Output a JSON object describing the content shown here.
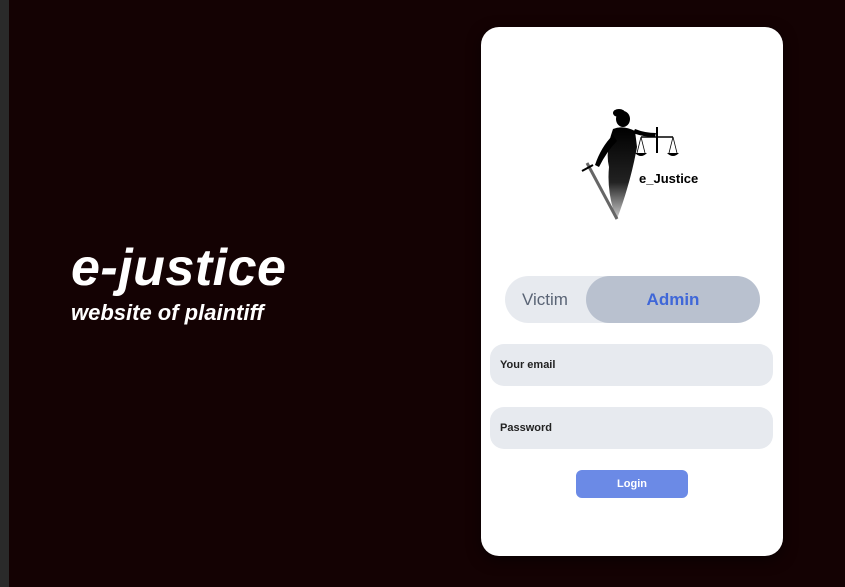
{
  "hero": {
    "title": "e-justice",
    "subtitle": "website of plaintiff"
  },
  "card": {
    "logo_text": "e_Justice",
    "toggle": {
      "options": [
        "Victim",
        "Admin"
      ],
      "selected": "Admin"
    },
    "email": {
      "placeholder": "Your email",
      "value": ""
    },
    "password": {
      "placeholder": "Password",
      "value": ""
    },
    "login_label": "Login"
  },
  "colors": {
    "background": "#140203",
    "card": "#ffffff",
    "accent": "#6b8ae6",
    "admin_text": "#3f67d8",
    "field_bg": "#e7eaef"
  }
}
